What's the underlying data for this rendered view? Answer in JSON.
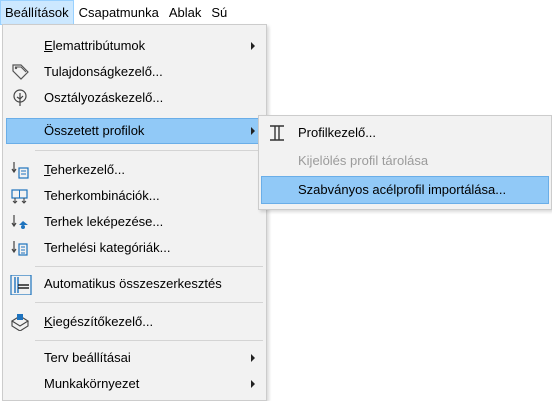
{
  "menubar": {
    "items": [
      {
        "label": "Beállítások"
      },
      {
        "label": "Csapatmunka"
      },
      {
        "label": "Ablak"
      },
      {
        "label": "Sú"
      }
    ]
  },
  "menu": {
    "items": [
      {
        "label": "Elemattribútumok",
        "icon": "none",
        "has_submenu": true
      },
      {
        "label": "Tulajdonságkezelő...",
        "icon": "tag-icon"
      },
      {
        "label": "Osztályozáskezelő...",
        "icon": "tree-icon"
      },
      {
        "label": "Összetett profilok",
        "icon": "none",
        "has_submenu": true,
        "state": "highlighted"
      },
      {
        "label": "Teherkezelő...",
        "icon": "load-manager-icon"
      },
      {
        "label": "Teherkombinációk...",
        "icon": "load-combination-icon"
      },
      {
        "label": "Terhek leképezése...",
        "icon": "load-mapping-icon"
      },
      {
        "label": "Terhelési kategóriák...",
        "icon": "load-category-icon"
      },
      {
        "label": "Automatikus összeszerkesztés",
        "icon": "auto-connect-icon"
      },
      {
        "label": "Kiegészítőkezelő...",
        "icon": "add-on-icon"
      },
      {
        "label": "Terv beállításai",
        "icon": "none",
        "has_submenu": true
      },
      {
        "label": "Munkakörnyezet",
        "icon": "none",
        "has_submenu": true
      }
    ]
  },
  "submenu": {
    "items": [
      {
        "label": "Profilkezelő...",
        "icon": "profile-i-beam-icon"
      },
      {
        "label": "Kijelölés profil tárolása",
        "icon": "none",
        "state": "disabled"
      },
      {
        "label": "Szabványos acélprofil importálása...",
        "icon": "none",
        "state": "highlighted"
      }
    ]
  },
  "colors": {
    "menu_background": "#f2f2f2",
    "highlight": "#91c9f7",
    "highlight_border": "#6aaee8",
    "menubar_active": "#cce8ff",
    "disabled_text": "#9b9b9b",
    "icon_blue": "#1e73be"
  }
}
